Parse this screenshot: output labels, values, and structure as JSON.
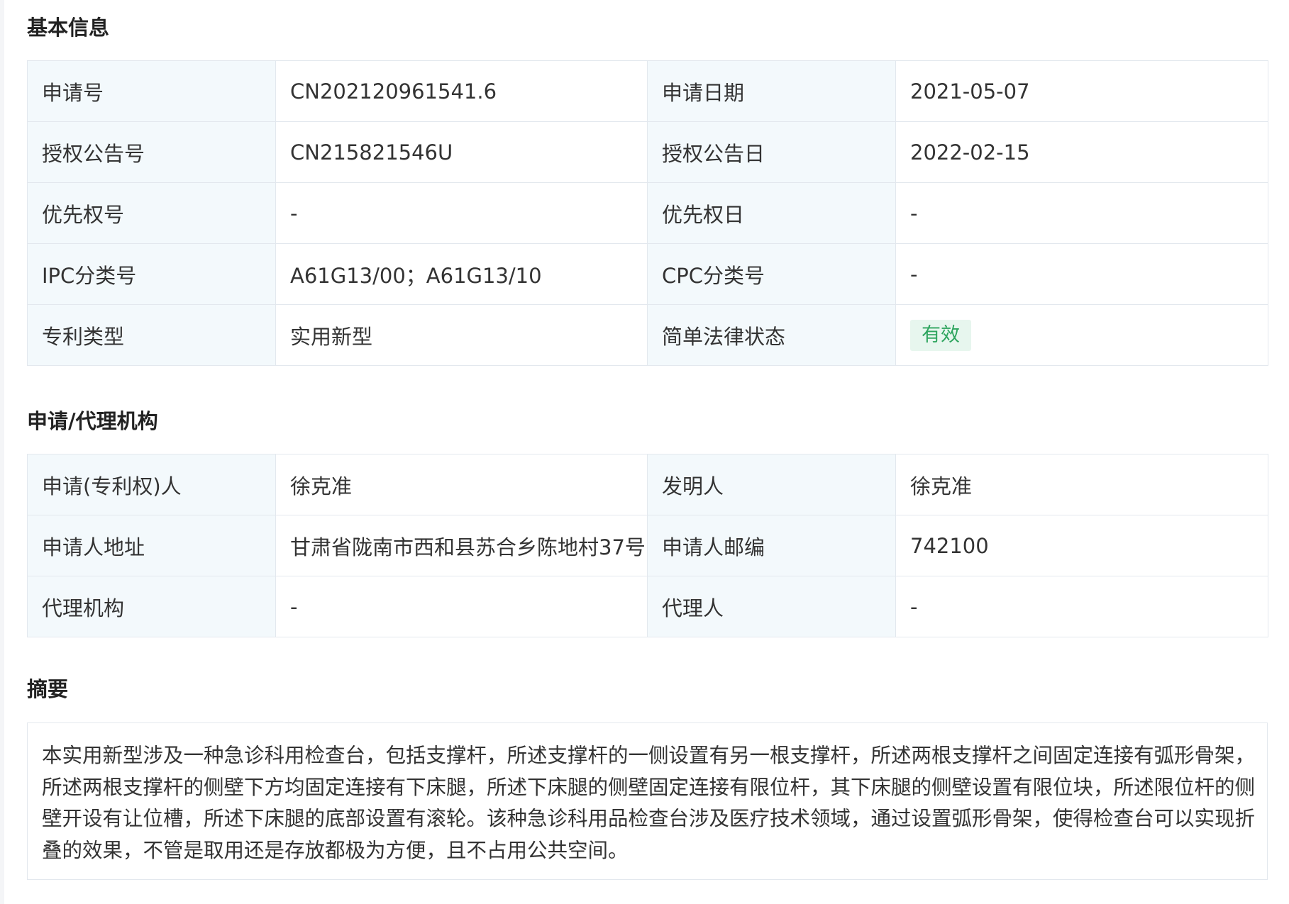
{
  "sections": {
    "basic_info_title": "基本信息",
    "agency_title": "申请/代理机构",
    "abstract_title": "摘要"
  },
  "basic_info": {
    "rows": [
      {
        "label1": "申请号",
        "value1": "CN202120961541.6",
        "label2": "申请日期",
        "value2": "2021-05-07"
      },
      {
        "label1": "授权公告号",
        "value1": "CN215821546U",
        "label2": "授权公告日",
        "value2": "2022-02-15"
      },
      {
        "label1": "优先权号",
        "value1": "-",
        "label2": "优先权日",
        "value2": "-"
      },
      {
        "label1": "IPC分类号",
        "value1": "A61G13/00；A61G13/10",
        "label2": "CPC分类号",
        "value2": "-"
      },
      {
        "label1": "专利类型",
        "value1": "实用新型",
        "label2": "简单法律状态",
        "value2": "有效"
      }
    ]
  },
  "agency_info": {
    "rows": [
      {
        "label1": "申请(专利权)人",
        "value1": "徐克准",
        "label2": "发明人",
        "value2": "徐克准"
      },
      {
        "label1": "申请人地址",
        "value1": "甘肃省陇南市西和县苏合乡陈地村37号",
        "label2": "申请人邮编",
        "value2": "742100"
      },
      {
        "label1": "代理机构",
        "value1": "-",
        "label2": "代理人",
        "value2": "-"
      }
    ]
  },
  "abstract": {
    "lines": [
      "本实用新型涉及一种急诊科用检查台，包括支撑杆，所述支撑杆的一侧设置有另一根支撑杆，所述两根支撑杆之间固定连接有弧形骨架，",
      "所述两根支撑杆的侧壁下方均固定连接有下床腿，所述下床腿的侧壁固定连接有限位杆，其下床腿的侧壁设置有限位块，所述限位杆的侧",
      "壁开设有让位槽，所述下床腿的底部设置有滚轮。该种急诊科用品检查台涉及医疗技术领域，通过设置弧形骨架，使得检查台可以实现折",
      "叠的效果，不管是取用还是存放都极为方便，且不占用公共空间。"
    ]
  },
  "colors": {
    "label_bg": "#f3f9fc",
    "border": "#e3e8ee",
    "status_green": "#2ea55e",
    "status_bg": "#e7f6ee"
  }
}
